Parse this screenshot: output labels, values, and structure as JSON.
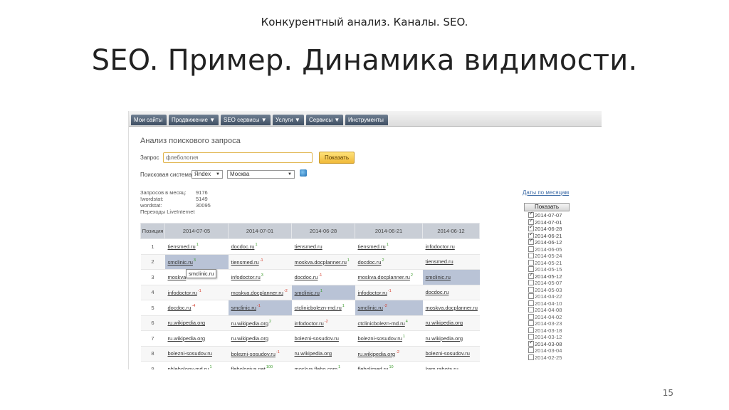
{
  "slide": {
    "subtitle": "Конкурентный анализ. Каналы. SEO.",
    "title": "SEO. Пример. Динамика видимости.",
    "page_number": "15"
  },
  "nav": {
    "tabs": [
      "Мои сайты",
      "Продвижение ▼",
      "SEO сервисы ▼",
      "Услуги ▼",
      "Сервисы ▼",
      "Инструменты"
    ]
  },
  "panel": {
    "title": "Анализ поискового запроса",
    "query_label": "Запрос",
    "query_value": "флебология",
    "show_button": "Показать",
    "engine_label": "Поисковая система:",
    "engine_value": "Яndex",
    "region_value": "Москва"
  },
  "stats": [
    {
      "label": "Запросов в месяц:",
      "value": "9176"
    },
    {
      "label": "!wordstat:",
      "value": "5149"
    },
    {
      "label": "wordstat:",
      "value": "30095"
    },
    {
      "label": "Переходы LiveInternet",
      "value": ""
    }
  ],
  "sidebar": {
    "by_month_link": "Даты по месяцам",
    "show_button": "Показать",
    "dates": [
      {
        "date": "2014-07-07",
        "checked": true
      },
      {
        "date": "2014-07-01",
        "checked": true
      },
      {
        "date": "2014-06-28",
        "checked": true
      },
      {
        "date": "2014-06-21",
        "checked": true
      },
      {
        "date": "2014-06-12",
        "checked": true
      },
      {
        "date": "2014-06-05",
        "checked": false
      },
      {
        "date": "2014-05-24",
        "checked": false
      },
      {
        "date": "2014-05-21",
        "checked": false
      },
      {
        "date": "2014-05-15",
        "checked": false
      },
      {
        "date": "2014-05-12",
        "checked": true
      },
      {
        "date": "2014-05-07",
        "checked": false
      },
      {
        "date": "2014-05-03",
        "checked": false
      },
      {
        "date": "2014-04-22",
        "checked": false
      },
      {
        "date": "2014-04-10",
        "checked": false
      },
      {
        "date": "2014-04-08",
        "checked": false
      },
      {
        "date": "2014-04-02",
        "checked": false
      },
      {
        "date": "2014-03-23",
        "checked": false
      },
      {
        "date": "2014-03-18",
        "checked": false
      },
      {
        "date": "2014-03-12",
        "checked": false
      },
      {
        "date": "2014-03-08",
        "checked": true
      },
      {
        "date": "2014-03-04",
        "checked": false
      },
      {
        "date": "2014-02-25",
        "checked": false
      }
    ]
  },
  "table": {
    "columns": [
      "Позиция",
      "2014-07-05",
      "2014-07-01",
      "2014-06-28",
      "2014-06-21",
      "2014-06-12"
    ],
    "rows": [
      {
        "pos": "1",
        "cells": [
          {
            "t": "tiensmed.ru",
            "c": "1",
            "d": "up"
          },
          {
            "t": "docdoc.ru",
            "c": "1",
            "d": "up"
          },
          {
            "t": "tiensmed.ru",
            "c": "",
            "d": ""
          },
          {
            "t": "tiensmed.ru",
            "c": "1",
            "d": "up"
          },
          {
            "t": "infodoctor.ru",
            "c": "",
            "d": ""
          }
        ]
      },
      {
        "pos": "2",
        "cells": [
          {
            "t": "smclinic.ru",
            "c": "3",
            "d": "up",
            "hl": true
          },
          {
            "t": "tiensmed.ru",
            "c": "-1",
            "d": "down"
          },
          {
            "t": "moskva.docplanner.ru",
            "c": "1",
            "d": "up"
          },
          {
            "t": "docdoc.ru",
            "c": "2",
            "d": "up"
          },
          {
            "t": "tiensmed.ru",
            "c": "",
            "d": ""
          }
        ]
      },
      {
        "pos": "3",
        "cells": [
          {
            "t": "moskva",
            "c": "",
            "d": ""
          },
          {
            "t": "infodoctor.ru",
            "c": "3",
            "d": "up"
          },
          {
            "t": "docdoc.ru",
            "c": "-1",
            "d": "down"
          },
          {
            "t": "moskva.docplanner.ru",
            "c": "2",
            "d": "up"
          },
          {
            "t": "smclinic.ru",
            "c": "",
            "d": "",
            "hl": true
          }
        ]
      },
      {
        "pos": "4",
        "cells": [
          {
            "t": "infodoctor.ru",
            "c": "-1",
            "d": "down"
          },
          {
            "t": "moskva.docplanner.ru",
            "c": "-2",
            "d": "down"
          },
          {
            "t": "smclinic.ru",
            "c": "1",
            "d": "up",
            "hl": true
          },
          {
            "t": "infodoctor.ru",
            "c": "-1",
            "d": "down"
          },
          {
            "t": "docdoc.ru",
            "c": "",
            "d": ""
          }
        ]
      },
      {
        "pos": "5",
        "cells": [
          {
            "t": "docdoc.ru",
            "c": "-4",
            "d": "down"
          },
          {
            "t": "smclinic.ru",
            "c": "-1",
            "d": "down",
            "hl": true
          },
          {
            "t": "ctclinicbolezn-md.ru",
            "c": "1",
            "d": "up"
          },
          {
            "t": "smclinic.ru",
            "c": "-2",
            "d": "down",
            "hl": true
          },
          {
            "t": "moskva.docplanner.ru",
            "c": "",
            "d": ""
          }
        ]
      },
      {
        "pos": "6",
        "cells": [
          {
            "t": "ru.wikipedia.org",
            "c": "",
            "d": ""
          },
          {
            "t": "ru.wikipedia.org",
            "c": "2",
            "d": "up"
          },
          {
            "t": "infodoctor.ru",
            "c": "-2",
            "d": "down"
          },
          {
            "t": "ctclinicbolezn-md.ru",
            "c": "4",
            "d": "up"
          },
          {
            "t": "ru.wikipedia.org",
            "c": "",
            "d": ""
          }
        ]
      },
      {
        "pos": "7",
        "cells": [
          {
            "t": "ru.wikipedia.org",
            "c": "",
            "d": ""
          },
          {
            "t": "ru.wikipedia.org",
            "c": "",
            "d": ""
          },
          {
            "t": "bolezni-sosudov.ru",
            "c": "",
            "d": ""
          },
          {
            "t": "bolezni-sosudov.ru",
            "c": "1",
            "d": "up"
          },
          {
            "t": "ru.wikipedia.org",
            "c": "",
            "d": ""
          }
        ]
      },
      {
        "pos": "8",
        "cells": [
          {
            "t": "bolezni-sosudov.ru",
            "c": "",
            "d": ""
          },
          {
            "t": "bolezni-sosudov.ru",
            "c": "-1",
            "d": "down"
          },
          {
            "t": "ru.wikipedia.org",
            "c": "",
            "d": ""
          },
          {
            "t": "ru.wikipedia.org",
            "c": "-2",
            "d": "down"
          },
          {
            "t": "bolezni-sosudov.ru",
            "c": "",
            "d": ""
          }
        ]
      },
      {
        "pos": "9",
        "cells": [
          {
            "t": "phlebology-md.ru",
            "c": "1",
            "d": "up"
          },
          {
            "t": "flebologiya.net",
            "c": "100",
            "d": "up"
          },
          {
            "t": "moskva.flebo.com",
            "c": "1",
            "d": "up"
          },
          {
            "t": "flebolimed.ru",
            "c": "10",
            "d": "up"
          },
          {
            "t": "kem.rabota.ru",
            "c": "",
            "d": ""
          }
        ]
      }
    ],
    "tooltip": "smclinic.ru"
  }
}
